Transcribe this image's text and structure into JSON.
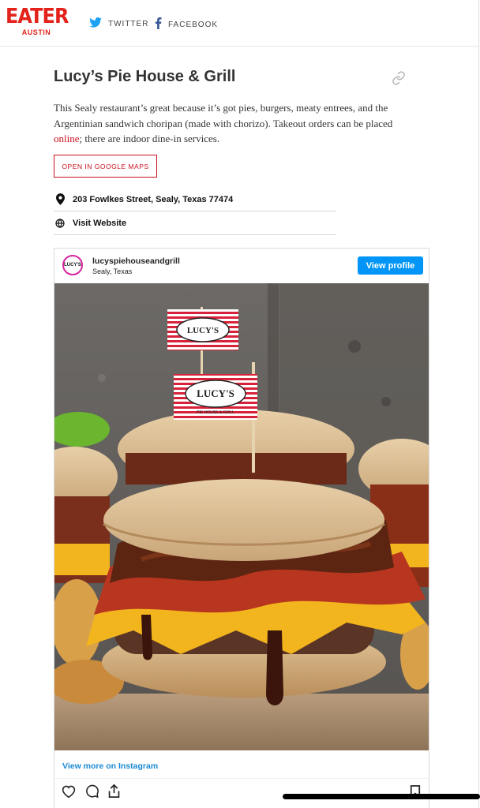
{
  "header": {
    "logo_main": "EATER",
    "logo_sub": "AUSTIN",
    "twitter_label": "TWITTER",
    "facebook_label": "FACEBOOK"
  },
  "place": {
    "title": "Lucy’s Pie House & Grill",
    "description_before": "This Sealy restaurant’s great because it’s got pies, burgers, meaty entrees, and the Argentinian sandwich choripan (made with chorizo). Takeout orders can be placed ",
    "description_link": "online",
    "description_after": "; there are indoor dine-in services.",
    "maps_button": "OPEN IN GOOGLE MAPS",
    "address": "203 Fowlkes Street, Sealy, Texas 77474",
    "website_label": "Visit Website"
  },
  "instagram": {
    "username": "lucyspiehouseandgrill",
    "location": "Sealy, Texas",
    "view_profile": "View profile",
    "view_more": "View more on Instagram",
    "avatar_text": "LUCY'S",
    "flag_text": "LUCY'S",
    "flag_subtext": "PIE HOUSE & GRILL"
  },
  "colors": {
    "brand_red": "#e3231b",
    "link_red": "#c8101e",
    "instagram_blue": "#0095f6"
  }
}
